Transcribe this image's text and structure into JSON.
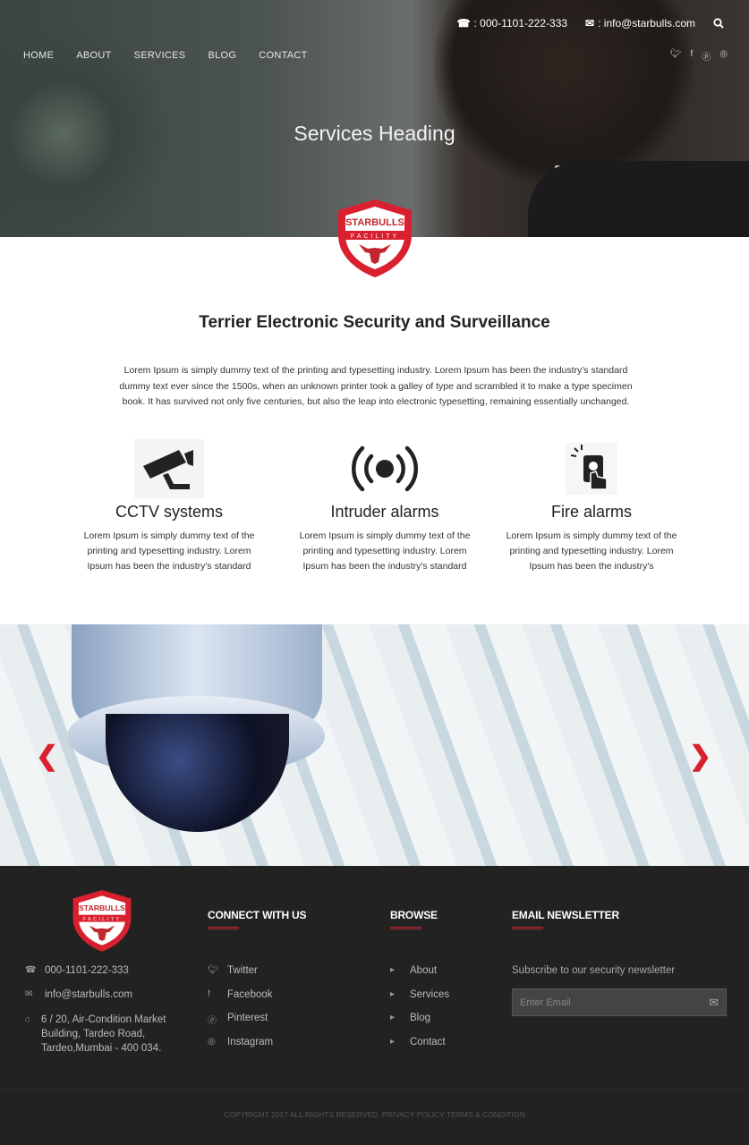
{
  "header": {
    "phone": ": 000-1101-222-333",
    "email": ": info@starbulls.com",
    "nav": [
      "HOME",
      "ABOUT",
      "SERVICES",
      "BLOG",
      "CONTACT"
    ],
    "social_icons": [
      "twitter-icon",
      "facebook-icon",
      "pinterest-icon",
      "instagram-icon"
    ]
  },
  "hero": {
    "title": "Services Heading"
  },
  "logo": {
    "text": "STARBULLS",
    "sub": "FACILITY"
  },
  "section": {
    "title": "Terrier Electronic Security and Surveillance",
    "intro": "Lorem Ipsum is simply dummy text of the printing and typesetting industry. Lorem Ipsum has been the industry's standard dummy text ever since the 1500s, when an unknown printer took a galley of type and scrambled it to make a type specimen book. It has survived not only five centuries, but also the leap into electronic typesetting, remaining essentially unchanged."
  },
  "features": [
    {
      "title": "CCTV systems",
      "text": "Lorem Ipsum is simply dummy text of the printing and typesetting industry. Lorem Ipsum has been the industry's standard",
      "icon": "cctv-camera-icon"
    },
    {
      "title": "Intruder alarms",
      "text": "Lorem Ipsum is simply dummy text of the printing and typesetting industry. Lorem Ipsum has been the industry's standard",
      "icon": "alarm-signal-icon"
    },
    {
      "title": "Fire alarms",
      "text": "Lorem Ipsum is simply dummy text of the printing and typesetting industry. Lorem Ipsum has been the industry's",
      "icon": "fire-alarm-button-icon"
    }
  ],
  "footer": {
    "contact": [
      {
        "icon": "phone-icon",
        "text": "000-1101-222-333"
      },
      {
        "icon": "envelope-icon",
        "text": "info@starbulls.com"
      },
      {
        "icon": "home-icon",
        "text": "6 / 20, Air-Condition Market Building, Tardeo Road, Tardeo,Mumbai - 400 034."
      }
    ],
    "connect": {
      "title": "CONNECT WITH US",
      "items": [
        "Twitter",
        "Facebook",
        "Pinterest",
        "Instagram"
      ]
    },
    "browse": {
      "title": "BROWSE",
      "items": [
        "About",
        "Services",
        "Blog",
        "Contact"
      ]
    },
    "newsletter": {
      "title": "EMAIL NEWSLETTER",
      "subtitle": "Subscribe to our security newsletter",
      "placeholder": "Enter Email"
    },
    "copyright": "COPYRIGHT 2017 ALL RIGHTS RESERVED. PRIVACY POLICY TERMS & CONDITION"
  },
  "colors": {
    "accent": "#d8202f",
    "footer_bg": "#222222"
  }
}
